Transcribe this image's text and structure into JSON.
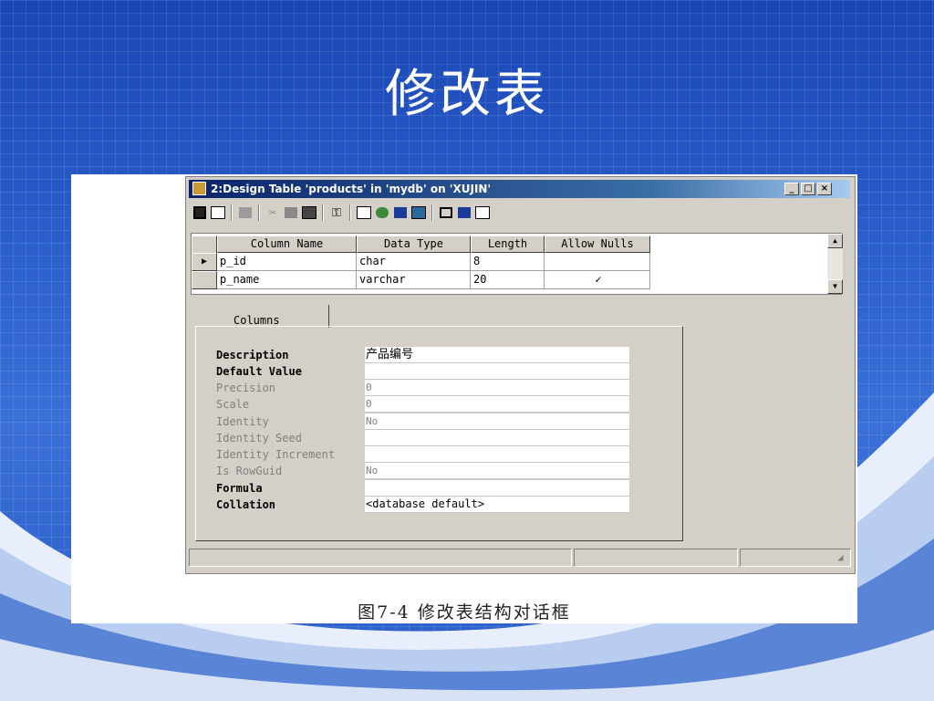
{
  "slide": {
    "title": "修改表",
    "caption": "图7-4  修改表结构对话框"
  },
  "window": {
    "title": "2:Design Table 'products' in 'mydb' on 'XUJIN'"
  },
  "toolbar": {
    "icons": [
      "save-icon",
      "properties-icon",
      "cut-icon",
      "copy-icon",
      "paste-icon",
      "primary-key-icon",
      "relationships-icon",
      "indexes-icon",
      "constraints-icon",
      "manage-triggers-icon",
      "dependencies-icon",
      "generate-script-icon",
      "table-icon"
    ]
  },
  "grid": {
    "headers": [
      "Column Name",
      "Data Type",
      "Length",
      "Allow Nulls"
    ],
    "rows": [
      {
        "name": "p_id",
        "type": "char",
        "length": "8",
        "nulls": ""
      },
      {
        "name": "p_name",
        "type": "varchar",
        "length": "20",
        "nulls": "✓"
      }
    ]
  },
  "tabs": {
    "columns": "Columns"
  },
  "properties": [
    {
      "label": "Description",
      "value": "产品编号"
    },
    {
      "label": "Default Value",
      "value": ""
    },
    {
      "label": "Precision",
      "value": "0"
    },
    {
      "label": "Scale",
      "value": "0"
    },
    {
      "label": "Identity",
      "value": "No"
    },
    {
      "label": "Identity Seed",
      "value": ""
    },
    {
      "label": "Identity Increment",
      "value": ""
    },
    {
      "label": "Is RowGuid",
      "value": "No"
    },
    {
      "label": "Formula",
      "value": ""
    },
    {
      "label": "Collation",
      "value": "<database default>"
    }
  ]
}
